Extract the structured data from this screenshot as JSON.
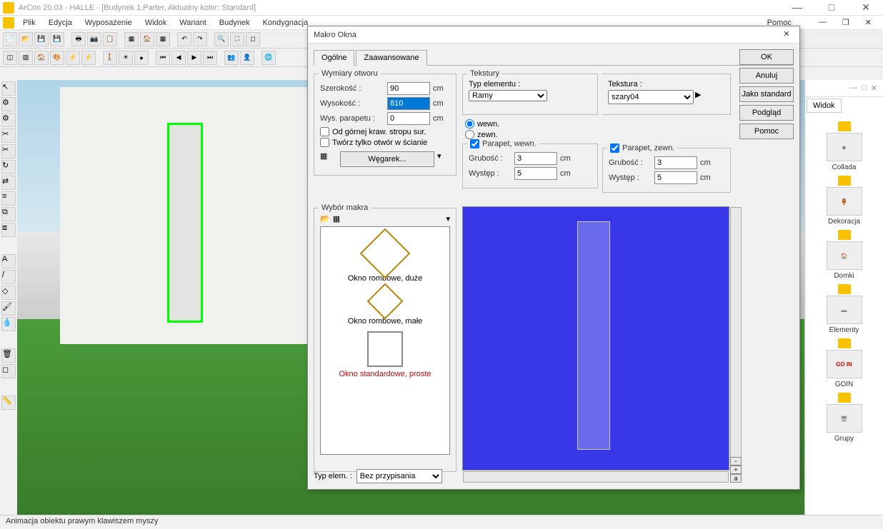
{
  "app": {
    "title": "ArCon 20.03 - HALLE - [Budynek 1,Parter, Aktualny kolor: Standard]"
  },
  "menu": {
    "items": [
      "Plik",
      "Edycja",
      "Wyposażenie",
      "Widok",
      "Wariant",
      "Budynek",
      "Kondygnacja"
    ],
    "help": "Pomoc"
  },
  "dialog": {
    "title": "Makro Okna",
    "tabs": {
      "general": "Ogólne",
      "advanced": "Zaawansowane"
    },
    "dimensions": {
      "legend": "Wymiary otworu",
      "width_lbl": "Szerokość :",
      "width": "90",
      "height_lbl": "Wysokość :",
      "height": "810",
      "sill_lbl": "Wys. parapetu :",
      "sill": "0",
      "unit": "cm",
      "chk1": "Od górnej kraw. stropu sur.",
      "chk2": "Twórz tylko otwór w ścianie",
      "lintel_btn": "Węgarek..."
    },
    "textures": {
      "legend": "Tekstury",
      "type_lbl": "Typ elementu :",
      "type_val": "Ramy",
      "radio_in": "wewn.",
      "radio_out": "zewn.",
      "tex_lbl": "Tekstura :",
      "tex_val": "szary04"
    },
    "sill_in": {
      "legend": "Parapet, wewn.",
      "thick_lbl": "Grubość :",
      "thick": "3",
      "over_lbl": "Występ :",
      "over": "5"
    },
    "sill_out": {
      "legend": "Parapet, zewn.",
      "thick_lbl": "Grubość :",
      "thick": "3",
      "over_lbl": "Występ :",
      "over": "5"
    },
    "macro": {
      "legend": "Wybór makra",
      "items": [
        "Okno rombowe, duże",
        "Okno rombowe, małe",
        "Okno standardowe, proste"
      ]
    },
    "typelem": {
      "lbl": "Typ elem. :",
      "val": "Bez przypisania"
    },
    "buttons": {
      "ok": "OK",
      "cancel": "Anuluj",
      "std": "Jako standard",
      "preview": "Podgląd",
      "help": "Pomoc"
    }
  },
  "sidebar": {
    "title": "Widok",
    "cats": [
      "Collada",
      "Dekoracja",
      "Domki",
      "Elementy",
      "GOIN",
      "Grupy"
    ],
    "goin_text": "GO IN"
  },
  "status": "Animacja obiektu prawym klawiszem myszy"
}
